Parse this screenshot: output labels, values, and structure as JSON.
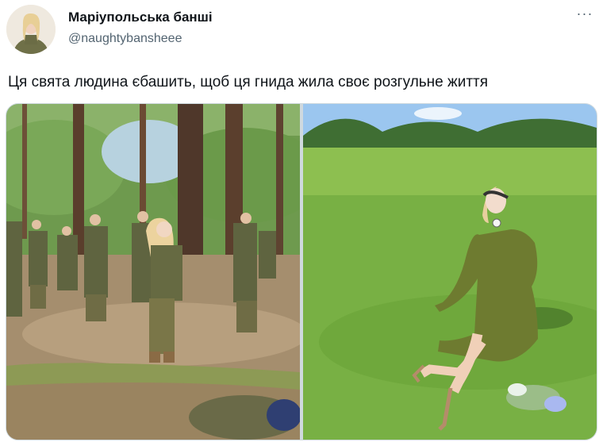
{
  "author": {
    "display_name": "Маріупольська банші",
    "handle": "@naughtybansheee"
  },
  "icons": {
    "avatar": "avatar-image",
    "more": "more-options-icon"
  },
  "header": {
    "more_label": "···"
  },
  "tweet": {
    "text": "Ця свята людина єбашить, щоб ця гнида жила своє розгульне життя"
  },
  "media": {
    "photos": [
      {
        "subject": "soldiers-in-forest-photo"
      },
      {
        "subject": "woman-on-lawn-photo"
      }
    ]
  },
  "colors": {
    "text": "#0f1419",
    "secondary_text": "#536471",
    "border": "#cfd9de"
  }
}
